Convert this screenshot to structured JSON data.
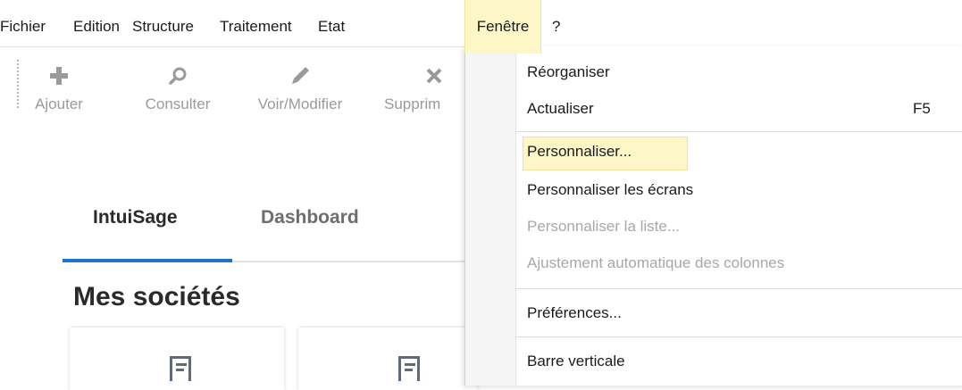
{
  "menubar": {
    "items": [
      "Fichier",
      "Edition",
      "Structure",
      "Traitement",
      "Etat",
      "Fenêtre",
      "?"
    ],
    "active": "Fenêtre"
  },
  "toolbar": {
    "buttons": [
      {
        "label": "Ajouter",
        "icon": "plus-icon"
      },
      {
        "label": "Consulter",
        "icon": "search-icon"
      },
      {
        "label": "Voir/Modifier",
        "icon": "pencil-icon"
      },
      {
        "label": "Supprim",
        "icon": "close-icon"
      }
    ]
  },
  "tabs": [
    "IntuiSage",
    "Dashboard"
  ],
  "section_title": "Mes sociétés",
  "dropdown": {
    "items": [
      {
        "label": "Réorganiser",
        "shortcut": "",
        "enabled": true
      },
      {
        "label": "Actualiser",
        "shortcut": "F5",
        "enabled": true
      },
      {
        "label": "Personnaliser...",
        "shortcut": "",
        "enabled": true,
        "highlighted": true
      },
      {
        "label": "Personnaliser les écrans",
        "shortcut": "",
        "enabled": true
      },
      {
        "label": "Personnaliser la liste...",
        "shortcut": "",
        "enabled": false
      },
      {
        "label": "Ajustement automatique des colonnes",
        "shortcut": "",
        "enabled": false
      },
      {
        "label": "Préférences...",
        "shortcut": "",
        "enabled": true
      },
      {
        "label": "Barre verticale",
        "shortcut": "",
        "enabled": true
      }
    ]
  },
  "colors": {
    "highlight": "#fdf7c8",
    "accent": "#1e73c8",
    "disabled_text": "#a8a8a8"
  }
}
